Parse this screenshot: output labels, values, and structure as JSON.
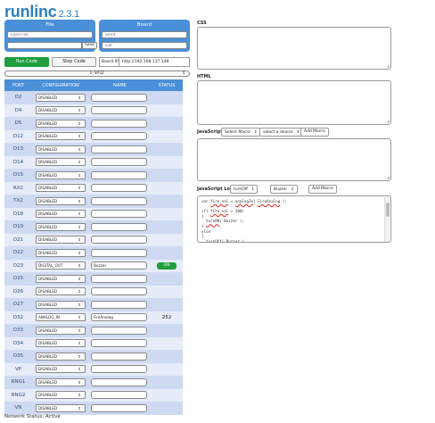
{
  "app": {
    "name": "runlinc",
    "version": "2.3.1"
  },
  "file_panel": {
    "title": "File",
    "load_placeholder": "Load File",
    "save_label": "Save"
  },
  "board_panel": {
    "title": "Board",
    "send_placeholder": "Send",
    "get_placeholder": "Get"
  },
  "toolbar": {
    "run_label": "Run Code",
    "stop_label": "Stop Code",
    "board_ip_label": "Board IP",
    "board_ip_value": "http://192.168.137.148"
  },
  "board_select": {
    "value": "E-SP32",
    "caret": "⇕"
  },
  "table": {
    "headers": [
      "PORT",
      "CONFIGURATION",
      "NAME",
      "STATUS"
    ],
    "rows": [
      {
        "port": "D2",
        "config": "DISABLED",
        "name": "",
        "status": ""
      },
      {
        "port": "D4",
        "config": "DISABLED",
        "name": "",
        "status": ""
      },
      {
        "port": "D5",
        "config": "DISABLED",
        "name": "",
        "status": ""
      },
      {
        "port": "D12",
        "config": "DISABLED",
        "name": "",
        "status": ""
      },
      {
        "port": "D13",
        "config": "DISABLED",
        "name": "",
        "status": ""
      },
      {
        "port": "D14",
        "config": "DISABLED",
        "name": "",
        "status": ""
      },
      {
        "port": "D15",
        "config": "DISABLED",
        "name": "",
        "status": ""
      },
      {
        "port": "RX2",
        "config": "DISABLED",
        "name": "",
        "status": ""
      },
      {
        "port": "TX2",
        "config": "DISABLED",
        "name": "",
        "status": ""
      },
      {
        "port": "D18",
        "config": "DISABLED",
        "name": "",
        "status": ""
      },
      {
        "port": "D19",
        "config": "DISABLED",
        "name": "",
        "status": ""
      },
      {
        "port": "D21",
        "config": "DISABLED",
        "name": "",
        "status": ""
      },
      {
        "port": "D22",
        "config": "DISABLED",
        "name": "",
        "status": ""
      },
      {
        "port": "D23",
        "config": "DIGITAL_OUT",
        "name": "Buzzer",
        "status": "ON"
      },
      {
        "port": "D25",
        "config": "DISABLED",
        "name": "",
        "status": ""
      },
      {
        "port": "D26",
        "config": "DISABLED",
        "name": "",
        "status": ""
      },
      {
        "port": "D27",
        "config": "DISABLED",
        "name": "",
        "status": ""
      },
      {
        "port": "D32",
        "config": "ANALOG_IN",
        "name": "FireAnalog",
        "status": "252"
      },
      {
        "port": "D33",
        "config": "DISABLED",
        "name": "",
        "status": ""
      },
      {
        "port": "D34",
        "config": "DISABLED",
        "name": "",
        "status": ""
      },
      {
        "port": "D35",
        "config": "DISABLED",
        "name": "",
        "status": ""
      },
      {
        "port": "VP",
        "config": "DISABLED",
        "name": "",
        "status": ""
      },
      {
        "port": "RNG1",
        "config": "DISABLED",
        "name": "",
        "status": ""
      },
      {
        "port": "RNG2",
        "config": "DISABLED",
        "name": "",
        "status": ""
      },
      {
        "port": "VN",
        "config": "DISABLED",
        "name": "",
        "status": ""
      }
    ]
  },
  "network_status": "Network Status: Active",
  "right": {
    "css_label": "CSS",
    "html_label": "HTML",
    "javascript_label": "JavaScript",
    "select_macro": "Select Macro",
    "select_device": "select a device",
    "add_macro": "Add Macro",
    "loop_label": "JavaScript Loop",
    "loop_macro": "turnOff",
    "loop_device": "Buzzer",
    "loop_add_macro": "Add Macro",
    "code_lines": [
      "var fire_val = analogIn( FireAnalog );",
      "",
      "if( fire_val > 200)",
      "{",
      "  turnON( Buzzer );",
      "}",
      "else",
      "{",
      "  turnOff( Buzzer );"
    ]
  },
  "colors": {
    "accent": "#4a8fd9",
    "run_green": "#1f9e3f",
    "row_odd": "#cfdaf2",
    "row_even": "#e6ecf8",
    "logo": "#2c7fc0"
  }
}
